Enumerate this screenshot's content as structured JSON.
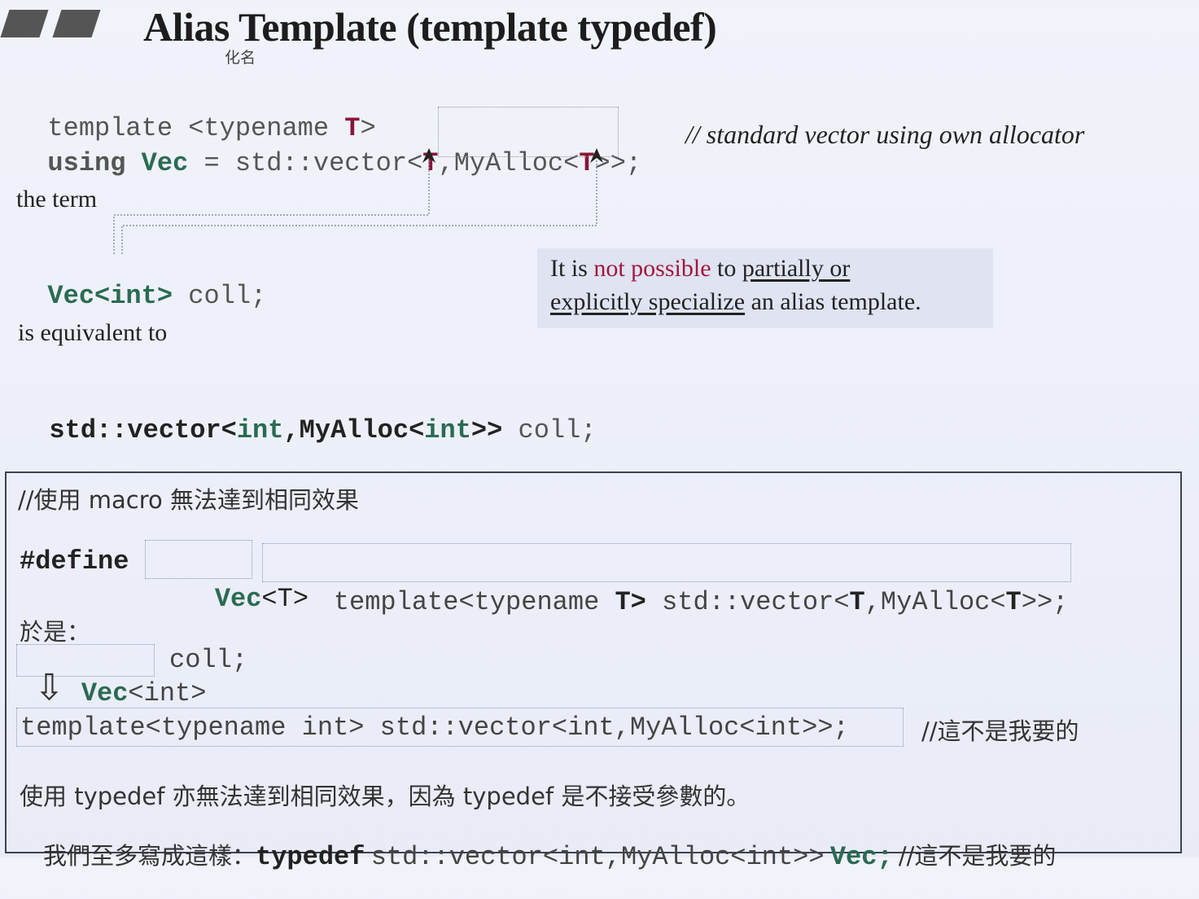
{
  "title": "Alias Template (template typedef)",
  "title_annotation": "化名",
  "code": {
    "line1_kw": "template",
    "line1_rest": "<typename",
    "line1_T": "T",
    "line1_close": ">",
    "line2_using": "using",
    "line2_vec": "Vec",
    "line2_eq": "=",
    "line2_vector": "std::vector<",
    "line2_T1": "T",
    "line2_comma": ",",
    "line2_myalloc": "MyAlloc<",
    "line2_T2": "T",
    "line2_end": ">",
    "line2_end2": ">;",
    "line2_comment": "// standard vector using own allocator"
  },
  "text": {
    "the_term": "the term",
    "vec_int": "Vec<int>",
    "coll": "coll;",
    "is_equivalent": "is equivalent to",
    "std_vector_bold": "std::vector<",
    "int1": "int",
    "comma_myalloc": ",MyAlloc<",
    "int2": "int",
    "closing": ">>",
    "coll2": "coll;"
  },
  "note": {
    "p1": "It is ",
    "p2": "not possible",
    "p3": " to ",
    "p4": "partially or",
    "p5": "explicitly specialize",
    "p6": " an alias template."
  },
  "macro_box": {
    "comment": "//使用 macro 無法達到相同效果",
    "define": "#define",
    "vec": "Vec",
    "vecT": "<T>",
    "define_body": "template<typename ",
    "define_T": "T>",
    "define_std": " std::vector<",
    "define_T2": "T",
    "define_my": ",MyAlloc<",
    "define_T3": "T",
    "define_end": ">>;",
    "so": "於是：",
    "use_vec": "Vec",
    "use_int": "<int>",
    "use_coll": "coll;",
    "arrow": "⇩",
    "expanded": "template<typename int> std::vector<int,MyAlloc<int>>;",
    "expanded_comment": "//這不是我要的",
    "typedef_line1": "使用 typedef 亦無法達到相同效果，因為 typedef 是不接受參數的。",
    "typedef_line2_cn": "我們至多寫成這樣：",
    "typedef_kw": "typedef",
    "typedef_body": "std::vector<int,MyAlloc<int>>",
    "typedef_vec": "Vec;",
    "typedef_comment": "//這不是我要的"
  }
}
